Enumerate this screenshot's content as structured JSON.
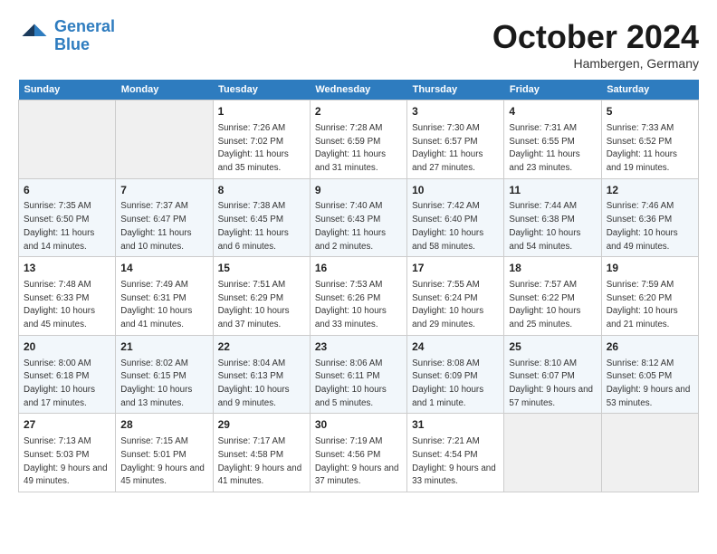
{
  "header": {
    "logo_line1": "General",
    "logo_line2": "Blue",
    "month": "October 2024",
    "location": "Hambergen, Germany"
  },
  "days_of_week": [
    "Sunday",
    "Monday",
    "Tuesday",
    "Wednesday",
    "Thursday",
    "Friday",
    "Saturday"
  ],
  "weeks": [
    [
      {
        "num": "",
        "sunrise": "",
        "sunset": "",
        "daylight": "",
        "empty": true
      },
      {
        "num": "",
        "sunrise": "",
        "sunset": "",
        "daylight": "",
        "empty": true
      },
      {
        "num": "1",
        "sunrise": "Sunrise: 7:26 AM",
        "sunset": "Sunset: 7:02 PM",
        "daylight": "Daylight: 11 hours and 35 minutes."
      },
      {
        "num": "2",
        "sunrise": "Sunrise: 7:28 AM",
        "sunset": "Sunset: 6:59 PM",
        "daylight": "Daylight: 11 hours and 31 minutes."
      },
      {
        "num": "3",
        "sunrise": "Sunrise: 7:30 AM",
        "sunset": "Sunset: 6:57 PM",
        "daylight": "Daylight: 11 hours and 27 minutes."
      },
      {
        "num": "4",
        "sunrise": "Sunrise: 7:31 AM",
        "sunset": "Sunset: 6:55 PM",
        "daylight": "Daylight: 11 hours and 23 minutes."
      },
      {
        "num": "5",
        "sunrise": "Sunrise: 7:33 AM",
        "sunset": "Sunset: 6:52 PM",
        "daylight": "Daylight: 11 hours and 19 minutes."
      }
    ],
    [
      {
        "num": "6",
        "sunrise": "Sunrise: 7:35 AM",
        "sunset": "Sunset: 6:50 PM",
        "daylight": "Daylight: 11 hours and 14 minutes."
      },
      {
        "num": "7",
        "sunrise": "Sunrise: 7:37 AM",
        "sunset": "Sunset: 6:47 PM",
        "daylight": "Daylight: 11 hours and 10 minutes."
      },
      {
        "num": "8",
        "sunrise": "Sunrise: 7:38 AM",
        "sunset": "Sunset: 6:45 PM",
        "daylight": "Daylight: 11 hours and 6 minutes."
      },
      {
        "num": "9",
        "sunrise": "Sunrise: 7:40 AM",
        "sunset": "Sunset: 6:43 PM",
        "daylight": "Daylight: 11 hours and 2 minutes."
      },
      {
        "num": "10",
        "sunrise": "Sunrise: 7:42 AM",
        "sunset": "Sunset: 6:40 PM",
        "daylight": "Daylight: 10 hours and 58 minutes."
      },
      {
        "num": "11",
        "sunrise": "Sunrise: 7:44 AM",
        "sunset": "Sunset: 6:38 PM",
        "daylight": "Daylight: 10 hours and 54 minutes."
      },
      {
        "num": "12",
        "sunrise": "Sunrise: 7:46 AM",
        "sunset": "Sunset: 6:36 PM",
        "daylight": "Daylight: 10 hours and 49 minutes."
      }
    ],
    [
      {
        "num": "13",
        "sunrise": "Sunrise: 7:48 AM",
        "sunset": "Sunset: 6:33 PM",
        "daylight": "Daylight: 10 hours and 45 minutes."
      },
      {
        "num": "14",
        "sunrise": "Sunrise: 7:49 AM",
        "sunset": "Sunset: 6:31 PM",
        "daylight": "Daylight: 10 hours and 41 minutes."
      },
      {
        "num": "15",
        "sunrise": "Sunrise: 7:51 AM",
        "sunset": "Sunset: 6:29 PM",
        "daylight": "Daylight: 10 hours and 37 minutes."
      },
      {
        "num": "16",
        "sunrise": "Sunrise: 7:53 AM",
        "sunset": "Sunset: 6:26 PM",
        "daylight": "Daylight: 10 hours and 33 minutes."
      },
      {
        "num": "17",
        "sunrise": "Sunrise: 7:55 AM",
        "sunset": "Sunset: 6:24 PM",
        "daylight": "Daylight: 10 hours and 29 minutes."
      },
      {
        "num": "18",
        "sunrise": "Sunrise: 7:57 AM",
        "sunset": "Sunset: 6:22 PM",
        "daylight": "Daylight: 10 hours and 25 minutes."
      },
      {
        "num": "19",
        "sunrise": "Sunrise: 7:59 AM",
        "sunset": "Sunset: 6:20 PM",
        "daylight": "Daylight: 10 hours and 21 minutes."
      }
    ],
    [
      {
        "num": "20",
        "sunrise": "Sunrise: 8:00 AM",
        "sunset": "Sunset: 6:18 PM",
        "daylight": "Daylight: 10 hours and 17 minutes."
      },
      {
        "num": "21",
        "sunrise": "Sunrise: 8:02 AM",
        "sunset": "Sunset: 6:15 PM",
        "daylight": "Daylight: 10 hours and 13 minutes."
      },
      {
        "num": "22",
        "sunrise": "Sunrise: 8:04 AM",
        "sunset": "Sunset: 6:13 PM",
        "daylight": "Daylight: 10 hours and 9 minutes."
      },
      {
        "num": "23",
        "sunrise": "Sunrise: 8:06 AM",
        "sunset": "Sunset: 6:11 PM",
        "daylight": "Daylight: 10 hours and 5 minutes."
      },
      {
        "num": "24",
        "sunrise": "Sunrise: 8:08 AM",
        "sunset": "Sunset: 6:09 PM",
        "daylight": "Daylight: 10 hours and 1 minute."
      },
      {
        "num": "25",
        "sunrise": "Sunrise: 8:10 AM",
        "sunset": "Sunset: 6:07 PM",
        "daylight": "Daylight: 9 hours and 57 minutes."
      },
      {
        "num": "26",
        "sunrise": "Sunrise: 8:12 AM",
        "sunset": "Sunset: 6:05 PM",
        "daylight": "Daylight: 9 hours and 53 minutes."
      }
    ],
    [
      {
        "num": "27",
        "sunrise": "Sunrise: 7:13 AM",
        "sunset": "Sunset: 5:03 PM",
        "daylight": "Daylight: 9 hours and 49 minutes."
      },
      {
        "num": "28",
        "sunrise": "Sunrise: 7:15 AM",
        "sunset": "Sunset: 5:01 PM",
        "daylight": "Daylight: 9 hours and 45 minutes."
      },
      {
        "num": "29",
        "sunrise": "Sunrise: 7:17 AM",
        "sunset": "Sunset: 4:58 PM",
        "daylight": "Daylight: 9 hours and 41 minutes."
      },
      {
        "num": "30",
        "sunrise": "Sunrise: 7:19 AM",
        "sunset": "Sunset: 4:56 PM",
        "daylight": "Daylight: 9 hours and 37 minutes."
      },
      {
        "num": "31",
        "sunrise": "Sunrise: 7:21 AM",
        "sunset": "Sunset: 4:54 PM",
        "daylight": "Daylight: 9 hours and 33 minutes."
      },
      {
        "num": "",
        "sunrise": "",
        "sunset": "",
        "daylight": "",
        "empty": true
      },
      {
        "num": "",
        "sunrise": "",
        "sunset": "",
        "daylight": "",
        "empty": true
      }
    ]
  ]
}
